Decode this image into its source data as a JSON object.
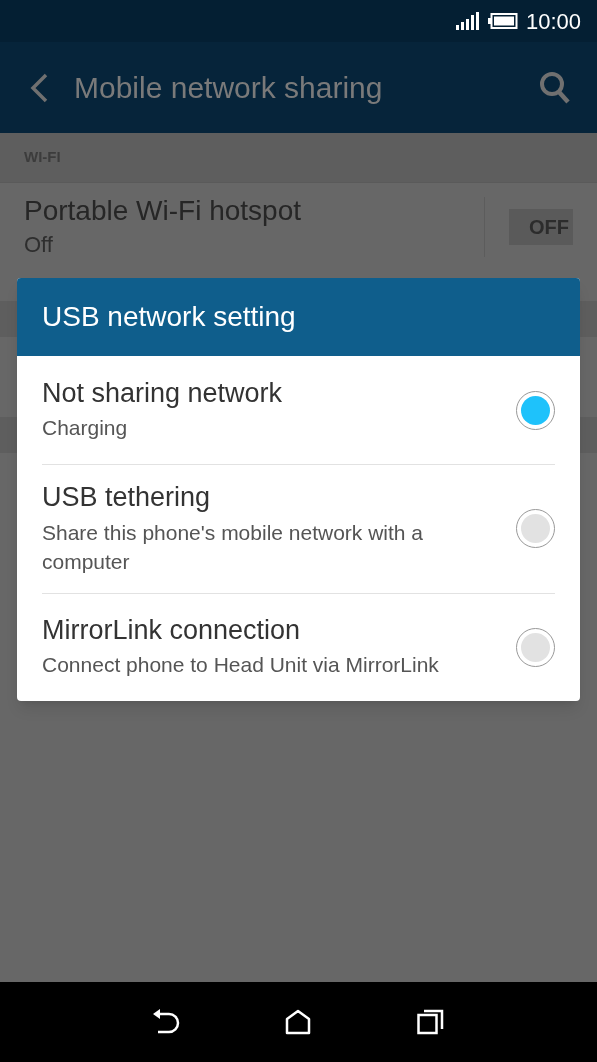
{
  "status_bar": {
    "time": "10:00"
  },
  "app_bar": {
    "title": "Mobile network sharing"
  },
  "section": {
    "header": "WI-FI"
  },
  "hotspot": {
    "title": "Portable Wi-Fi hotspot",
    "subtitle": "Off",
    "switch_label": "OFF",
    "on": false
  },
  "dialog": {
    "title": "USB network setting",
    "options": [
      {
        "title": "Not sharing network",
        "subtitle": "Charging",
        "selected": true
      },
      {
        "title": "USB tethering",
        "subtitle": "Share this phone's mobile network with a computer",
        "selected": false
      },
      {
        "title": "MirrorLink connection",
        "subtitle": "Connect phone to Head Unit via MirrorLink",
        "selected": false
      }
    ]
  }
}
